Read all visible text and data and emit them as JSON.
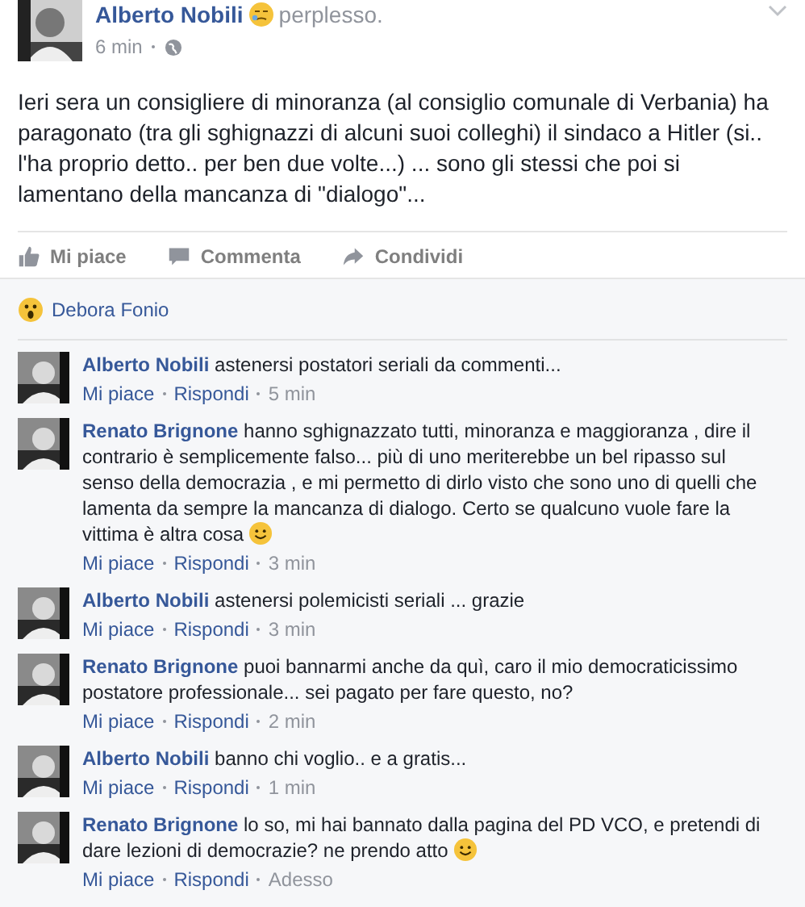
{
  "post": {
    "author": "Alberto Nobili",
    "feeling": "perplesso.",
    "time": "6 min",
    "text": "Ieri sera un consigliere di minoranza (al consiglio comunale di Verbania) ha paragonato (tra gli sghignazzi di alcuni suoi colleghi) il sindaco a Hitler (si.. l'ha proprio detto.. per ben due volte...) ... sono gli stessi che poi si lamentano della mancanza di \"dialogo\"...",
    "actions": [
      {
        "kind": "like",
        "label": "Mi piace"
      },
      {
        "kind": "comment",
        "label": "Commenta"
      },
      {
        "kind": "share",
        "label": "Condividi"
      }
    ]
  },
  "reactions": {
    "name": "Debora Fonio"
  },
  "comments": [
    {
      "author": "Alberto Nobili",
      "text": "astenersi postatori seriali da commenti...",
      "smiley": false,
      "like": "Mi piace",
      "reply": "Rispondi",
      "time": "5 min"
    },
    {
      "author": "Renato Brignone",
      "text": "hanno sghignazzato tutti, minoranza e maggioranza , dire il contrario è semplicemente falso... più di uno meriterebbe un bel ripasso sul senso della democrazia , e mi permetto di dirlo visto che sono uno di quelli che lamenta da sempre la mancanza di dialogo. Certo se qualcuno vuole fare la vittima è altra cosa",
      "smiley": true,
      "like": "Mi piace",
      "reply": "Rispondi",
      "time": "3 min"
    },
    {
      "author": "Alberto Nobili",
      "text": "astenersi polemicisti seriali ... grazie",
      "smiley": false,
      "like": "Mi piace",
      "reply": "Rispondi",
      "time": "3 min"
    },
    {
      "author": "Renato Brignone",
      "text": "puoi bannarmi anche da quì, caro il mio democraticissimo postatore professionale... sei pagato per fare questo, no?",
      "smiley": false,
      "like": "Mi piace",
      "reply": "Rispondi",
      "time": "2 min"
    },
    {
      "author": "Alberto Nobili",
      "text": "banno chi voglio.. e a gratis...",
      "smiley": false,
      "like": "Mi piace",
      "reply": "Rispondi",
      "time": "1 min"
    },
    {
      "author": "Renato Brignone",
      "text": "lo so, mi hai bannato dalla pagina del PD VCO, e pretendi di dare lezioni di democrazie? ne prendo atto",
      "smiley": true,
      "like": "Mi piace",
      "reply": "Rispondi",
      "time": "Adesso"
    }
  ]
}
